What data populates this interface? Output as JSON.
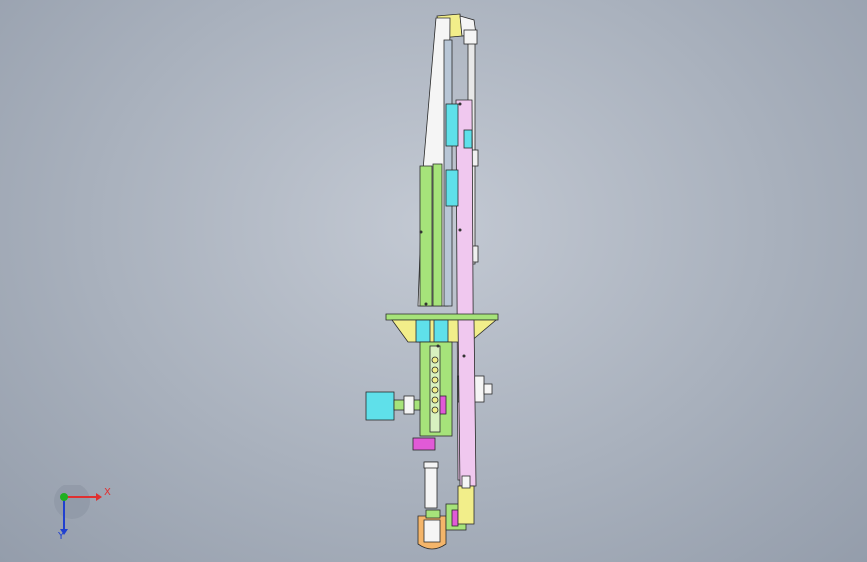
{
  "viewport": {
    "background_top": "#c3c9d3",
    "background_bottom": "#949dab"
  },
  "model": {
    "colors": {
      "pink": "#f0c8ef",
      "green": "#a6e37a",
      "cyan": "#5fe0ea",
      "yellow": "#f2ee8a",
      "white": "#f5f5f5",
      "gray_blue": "#b8c6d6",
      "magenta": "#e15ad7",
      "orange": "#f4b56a",
      "outline": "#2a2a2a"
    }
  },
  "triad": {
    "x_label": "X",
    "y_label": "Y",
    "x_color": "#e03030",
    "y_color": "#2040d0",
    "z_color": "#20b020"
  }
}
